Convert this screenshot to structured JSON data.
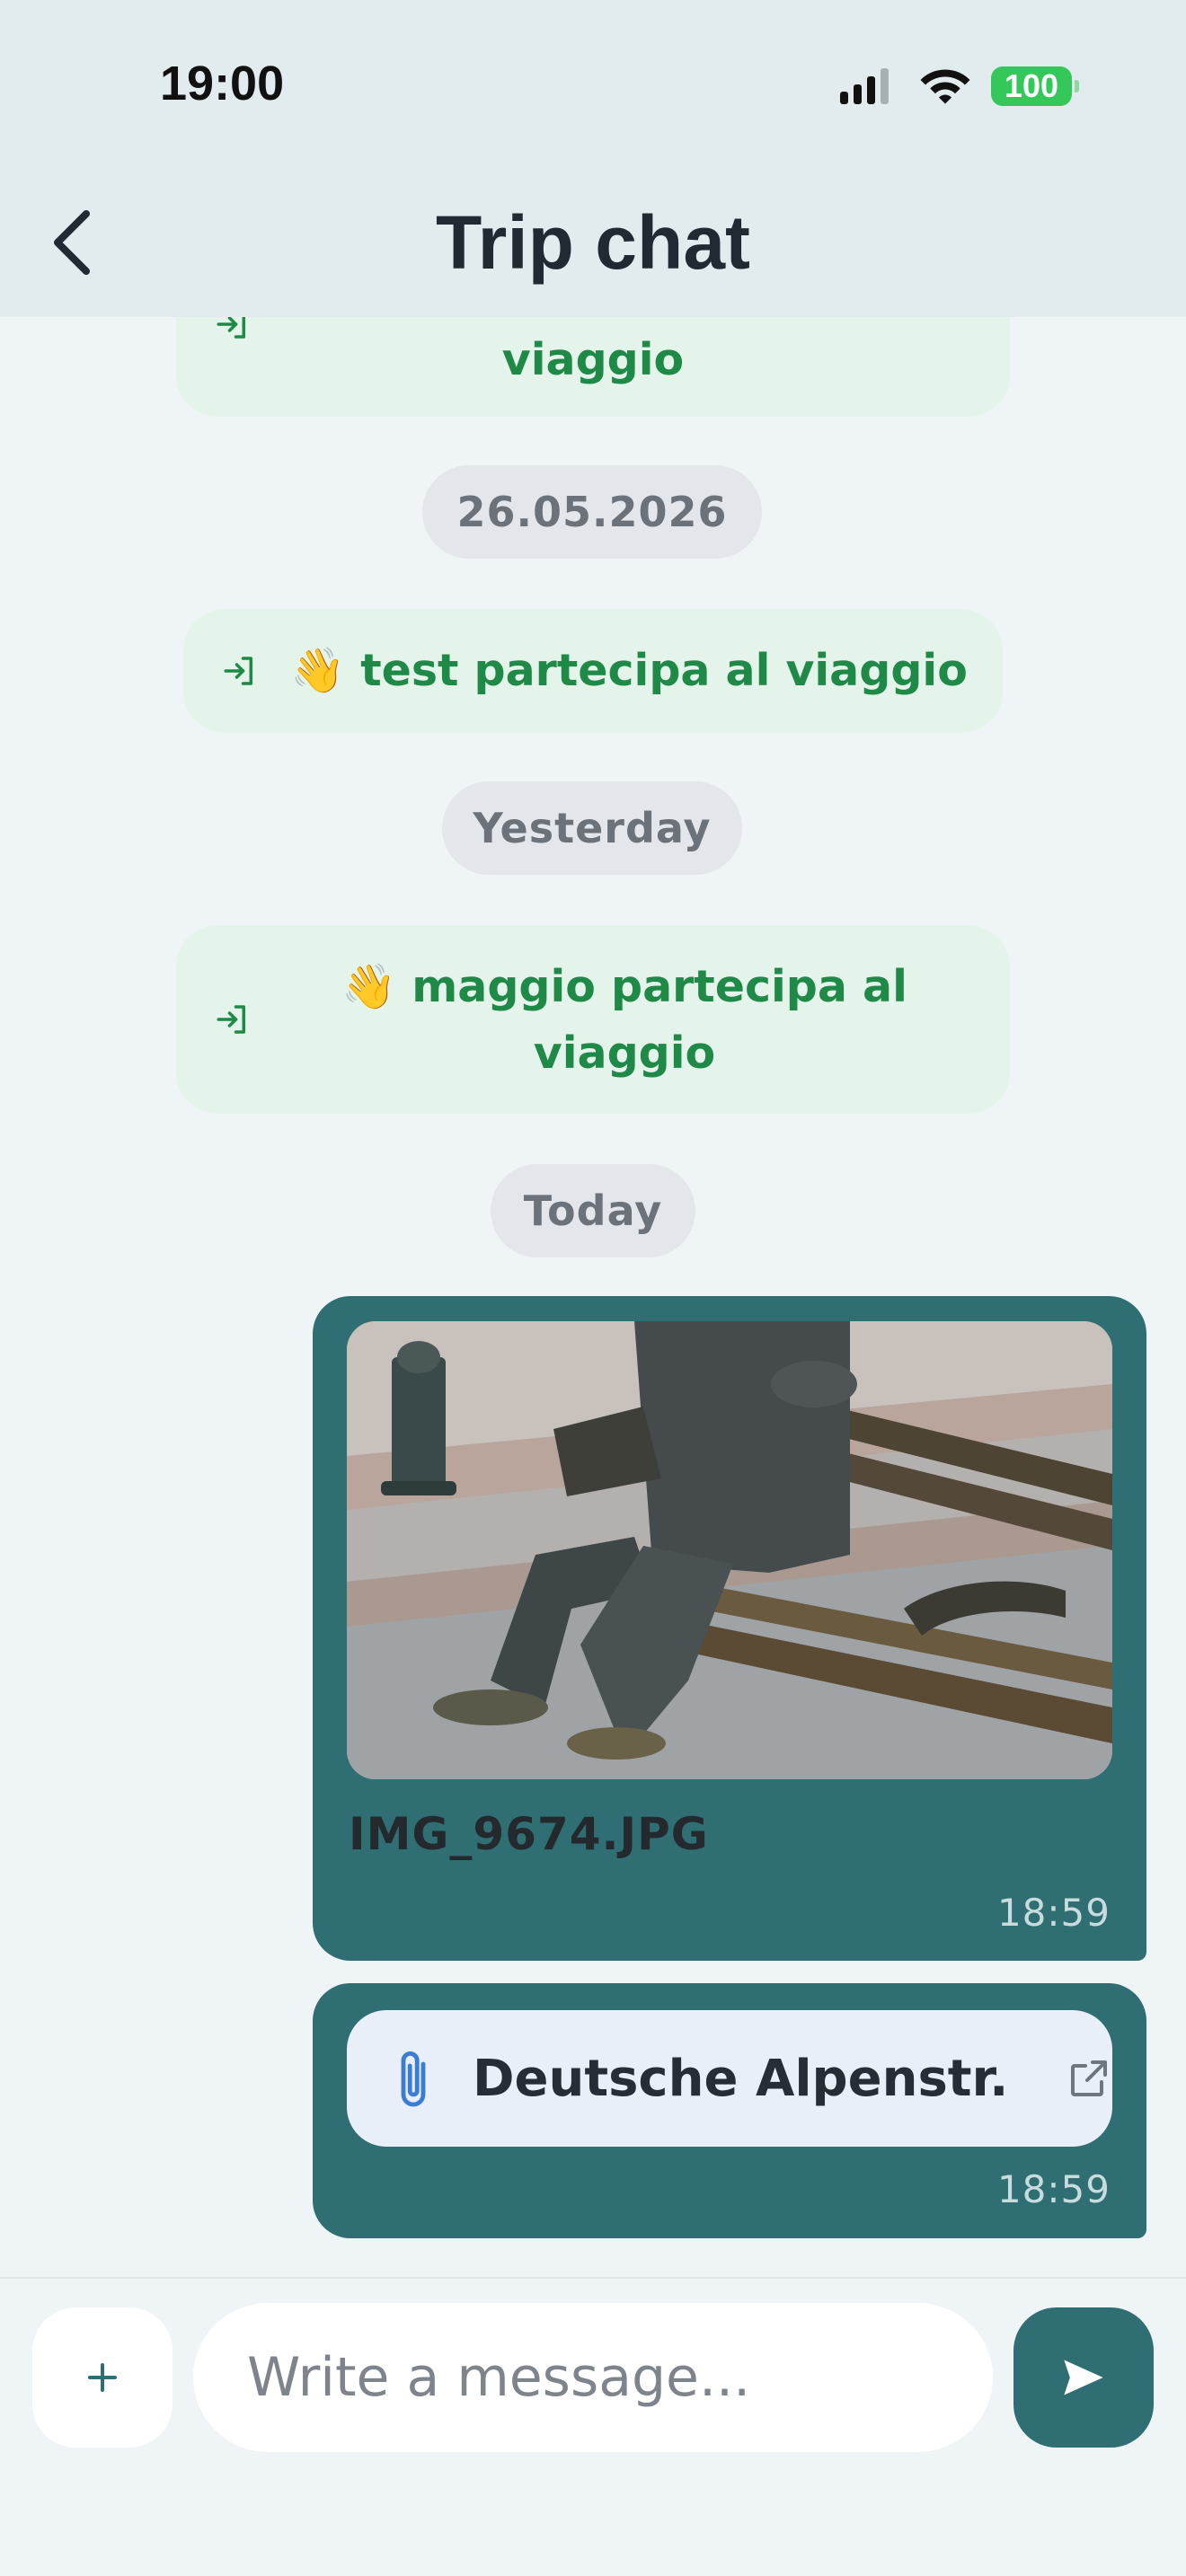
{
  "status_bar": {
    "time": "19:00",
    "battery": "100"
  },
  "header": {
    "title": "Trip chat"
  },
  "chat": {
    "system_top": {
      "text": "viaggio"
    },
    "date_1": "26.05.2026",
    "system_1": {
      "emoji": "👋",
      "text": "test partecipa al viaggio"
    },
    "date_2": "Yesterday",
    "system_2": {
      "emoji": "👋",
      "line1": "maggio partecipa al",
      "line2": "viaggio"
    },
    "date_3": "Today",
    "photo_message": {
      "file_name": "IMG_9674.JPG",
      "time": "18:59"
    },
    "file_message": {
      "file_name": "Deutsche Alpenstr...",
      "time": "18:59"
    }
  },
  "composer": {
    "placeholder": "Write a message..."
  },
  "colors": {
    "accent": "#2f6f73",
    "system_green": "#1f8a47",
    "system_bg": "#e5f4ea",
    "header_bg": "#e2ebee"
  },
  "icons": [
    "back-chevron-icon",
    "join-icon",
    "paperclip-icon",
    "external-link-icon",
    "plus-icon",
    "send-icon",
    "signal-icon",
    "wifi-icon",
    "battery-icon"
  ]
}
